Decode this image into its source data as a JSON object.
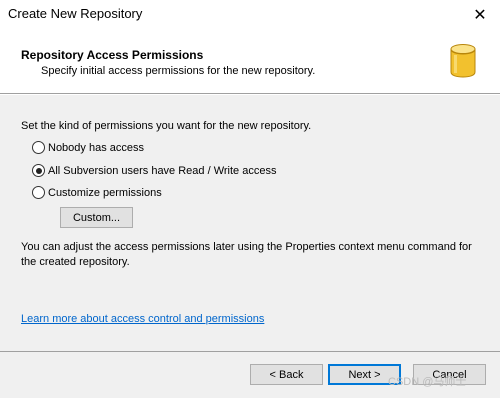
{
  "window": {
    "title": "Create New Repository",
    "close_glyph": "✕"
  },
  "header": {
    "title": "Repository Access Permissions",
    "subtitle": "Specify initial access permissions for the new repository.",
    "icon": "database-icon",
    "icon_color": "#f2c12e"
  },
  "body": {
    "prompt": "Set the kind of permissions you want for the new repository.",
    "options": [
      {
        "label": "Nobody has access",
        "selected": false
      },
      {
        "label": "All Subversion users have Read / Write access",
        "selected": true
      },
      {
        "label": "Customize permissions",
        "selected": false
      }
    ],
    "custom_button": "Custom...",
    "info": "You can adjust the access permissions later using the Properties context menu command for the created repository.",
    "link": "Learn more about access control and permissions"
  },
  "footer": {
    "back": "< Back",
    "next": "Next >",
    "cancel": "Cancel",
    "watermark": "CSDN @马师士"
  },
  "colors": {
    "accent": "#0078d7",
    "link": "#0066cc",
    "panel": "#f0f0f0"
  }
}
